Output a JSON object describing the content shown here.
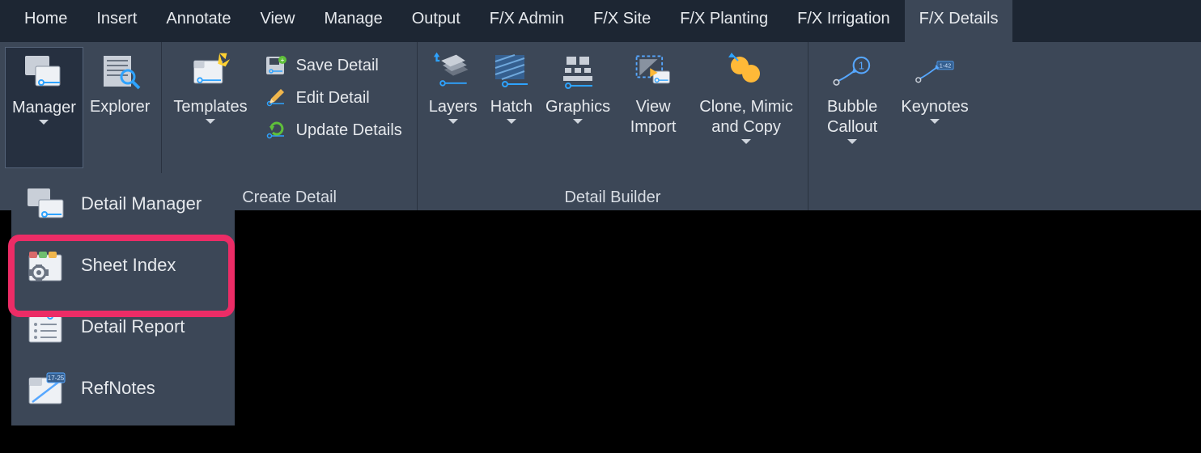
{
  "tabs": [
    {
      "label": "Home"
    },
    {
      "label": "Insert"
    },
    {
      "label": "Annotate"
    },
    {
      "label": "View"
    },
    {
      "label": "Manage"
    },
    {
      "label": "Output"
    },
    {
      "label": "F/X Admin"
    },
    {
      "label": "F/X Site"
    },
    {
      "label": "F/X Planting"
    },
    {
      "label": "F/X Irrigation"
    },
    {
      "label": "F/X Details"
    }
  ],
  "active_tab_index": 10,
  "ribbon": {
    "manager_panel": {
      "title": "",
      "manager": "Manager",
      "explorer": "Explorer"
    },
    "create_detail": {
      "title": "Create Detail",
      "templates": "Templates",
      "save_detail": "Save Detail",
      "edit_detail": "Edit Detail",
      "update_details": "Update Details"
    },
    "detail_builder": {
      "title": "Detail Builder",
      "layers": "Layers",
      "hatch": "Hatch",
      "graphics": "Graphics",
      "view_import": "View Import",
      "clone_mimic": "Clone, Mimic and Copy"
    },
    "right": {
      "bubble_callout": "Bubble Callout",
      "keynotes": "Keynotes"
    }
  },
  "dropdown": [
    {
      "label": "Detail Manager"
    },
    {
      "label": "Sheet Index"
    },
    {
      "label": "Detail Report"
    },
    {
      "label": "RefNotes"
    }
  ]
}
